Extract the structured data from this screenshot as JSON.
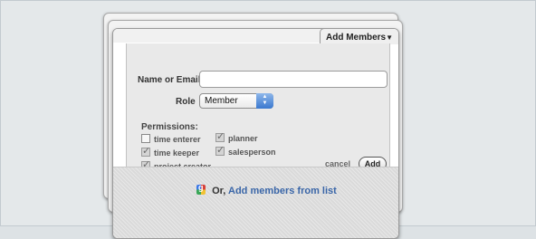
{
  "dialog": {
    "tab_label": "Add Members",
    "name_label": "Name or Email",
    "name_value": "",
    "role_label": "Role",
    "role_value": "Member",
    "permissions_title": "Permissions:",
    "permissions": [
      {
        "label": "time enterer",
        "checked": false
      },
      {
        "label": "time keeper",
        "checked": true
      },
      {
        "label": "project creator",
        "checked": true
      },
      {
        "label": "planner",
        "checked": true
      },
      {
        "label": "salesperson",
        "checked": true
      }
    ],
    "cancel_label": "cancel",
    "add_label": "Add"
  },
  "footer": {
    "prefix": "Or,",
    "link_label": "Add members from list",
    "icon": "google-contacts-icon"
  }
}
